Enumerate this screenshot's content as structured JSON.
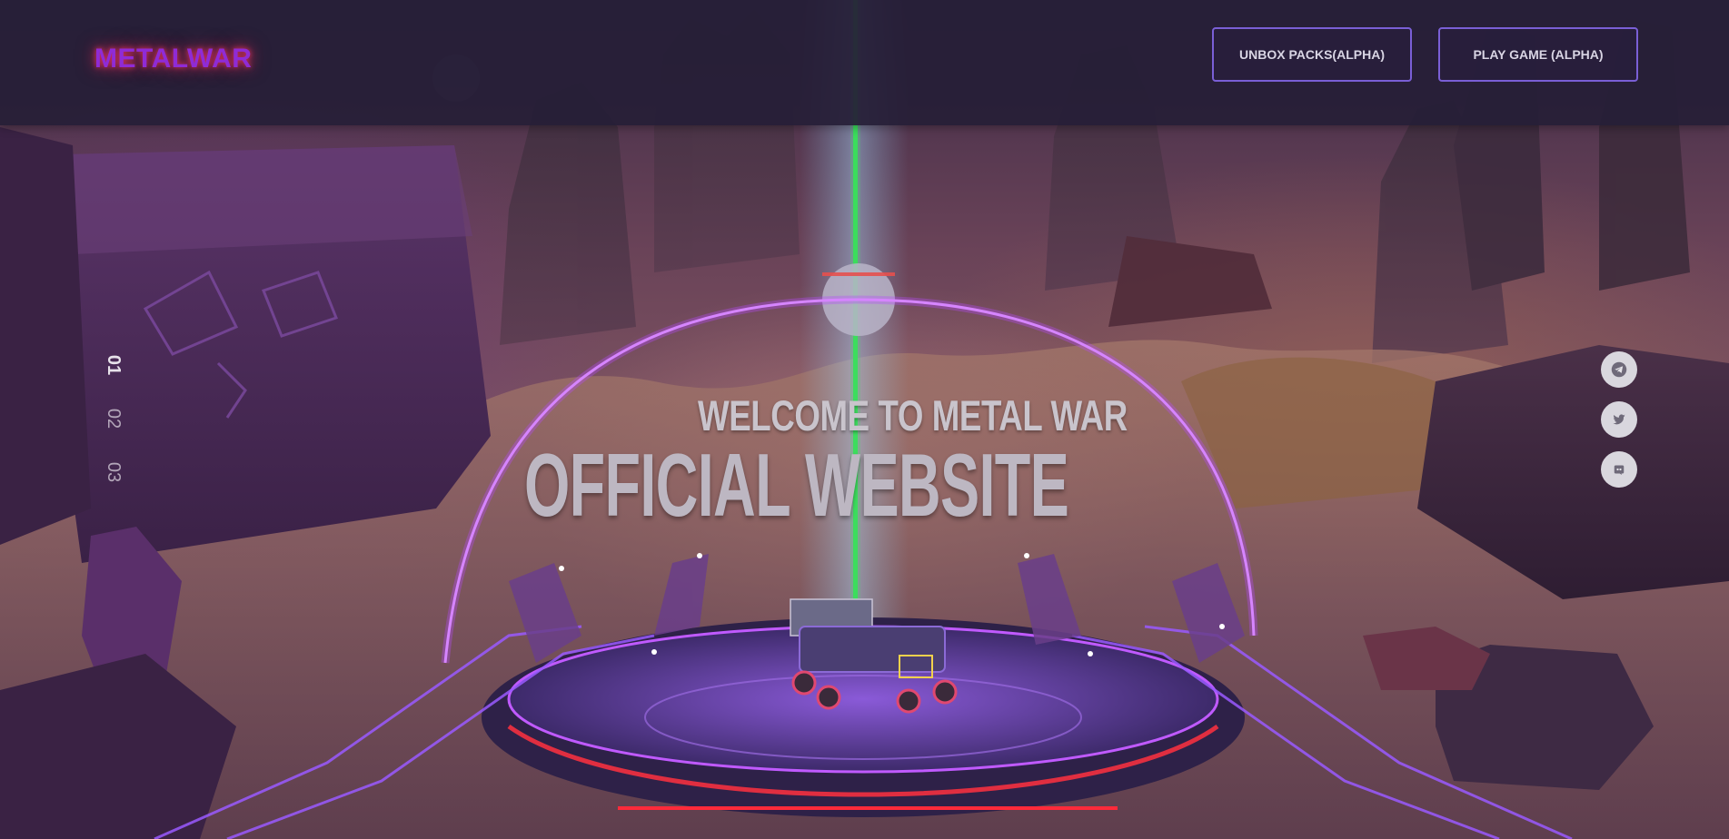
{
  "header": {
    "logo_text": "METALWAR",
    "buttons": [
      {
        "label": "UNBOX PACKS(ALPHA)"
      },
      {
        "label": "PLAY GAME (ALPHA)"
      }
    ]
  },
  "hero": {
    "welcome": "WELCOME TO METAL WAR",
    "title": "OFFICIAL WEBSITE"
  },
  "slides": [
    "01",
    "02",
    "03"
  ],
  "active_slide": "01",
  "social": [
    {
      "icon": "telegram-icon"
    },
    {
      "icon": "twitter-icon"
    },
    {
      "icon": "discord-icon"
    }
  ],
  "colors": {
    "accent_border": "#7a5fd6",
    "logo_purple": "#8f2bd6",
    "logo_glow": "#d4315a",
    "neon_arc": "#b64bff",
    "laser_green": "#39e05a"
  }
}
